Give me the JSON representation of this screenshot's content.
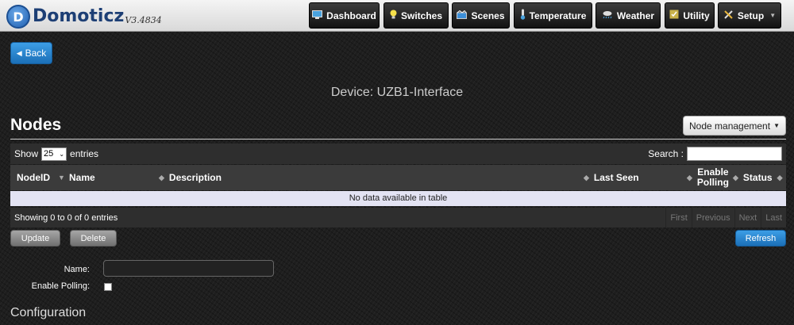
{
  "brand": {
    "name": "Domoticz",
    "version": "V3.4834",
    "logo_letter": "D"
  },
  "nav": [
    {
      "label": "Dashboard",
      "icon": "dashboard-icon"
    },
    {
      "label": "Switches",
      "icon": "lightbulb-icon"
    },
    {
      "label": "Scenes",
      "icon": "scenes-icon"
    },
    {
      "label": "Temperature",
      "icon": "thermometer-icon"
    },
    {
      "label": "Weather",
      "icon": "weather-icon"
    },
    {
      "label": "Utility",
      "icon": "utility-icon"
    },
    {
      "label": "Setup",
      "icon": "setup-icon"
    }
  ],
  "back_label": "Back",
  "device_title": "Device: UZB1-Interface",
  "nodes_title": "Nodes",
  "node_management_label": "Node management",
  "table": {
    "show_label": "Show",
    "entries_value": "25",
    "entries_label": "entries",
    "search_label": "Search :",
    "columns": [
      "NodeID",
      "Name",
      "Description",
      "Last Seen",
      "Enable Polling",
      "Status"
    ],
    "empty_text": "No data available in table",
    "info_text": "Showing 0 to 0 of 0 entries",
    "pager": [
      "First",
      "Previous",
      "Next",
      "Last"
    ]
  },
  "buttons": {
    "update": "Update",
    "delete": "Delete",
    "refresh": "Refresh"
  },
  "form": {
    "name_label": "Name:",
    "polling_label": "Enable Polling:"
  },
  "config_title": "Configuration",
  "colors": {
    "accent": "#2a86d0",
    "topbar": "#e6e6e6",
    "empty_row": "#e3e3f3"
  }
}
